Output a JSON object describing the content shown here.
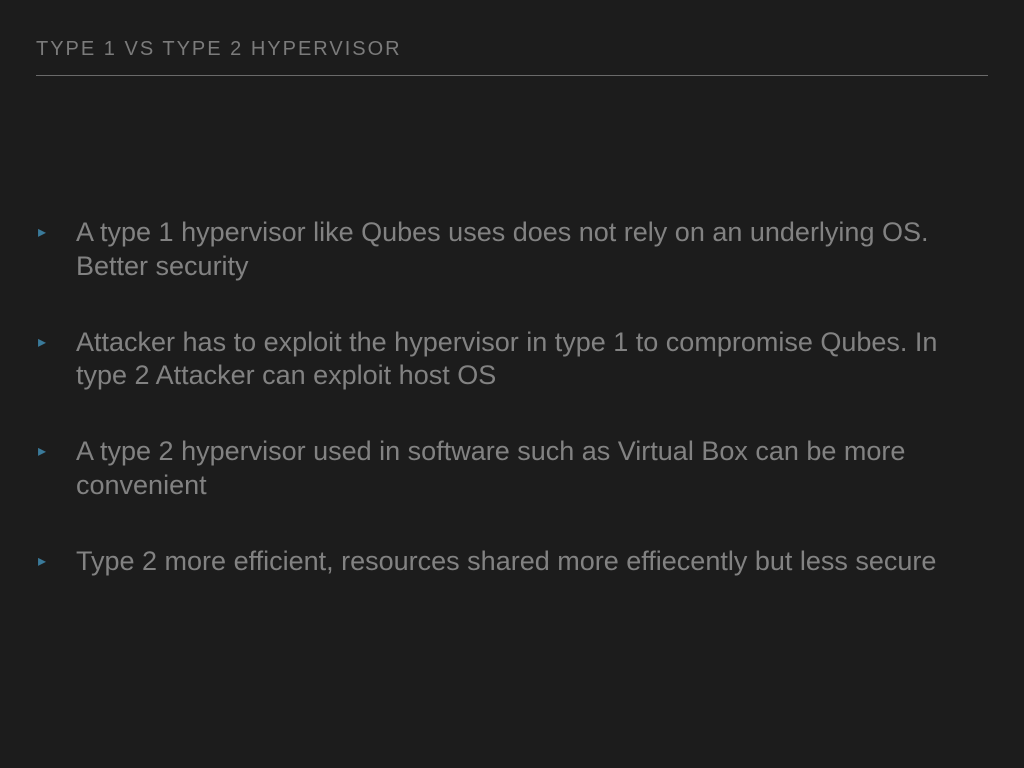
{
  "slide": {
    "title": "TYPE 1 VS TYPE 2 HYPERVISOR",
    "bullets": [
      "A type 1 hypervisor like Qubes uses does not rely on an underlying OS. Better security",
      "Attacker has to exploit the hypervisor in type 1 to compromise Qubes. In type 2 Attacker can exploit host OS",
      "A type 2 hypervisor used in software such as Virtual Box can be more convenient",
      "Type 2 more efficient, resources shared more effiecently but less secure"
    ]
  }
}
